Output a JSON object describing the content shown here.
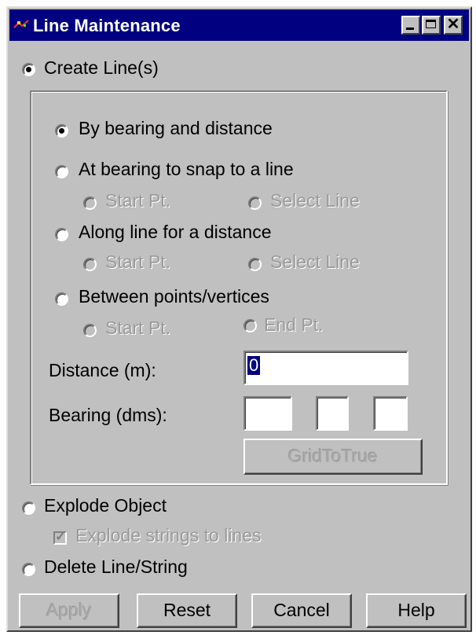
{
  "window": {
    "title": "Line Maintenance"
  },
  "create": {
    "label": "Create Line(s)"
  },
  "options": {
    "by_bearing_distance": "By bearing and distance",
    "snap_to_line": "At bearing to snap to a line",
    "along_line": "Along line for a distance",
    "between_points": "Between points/vertices"
  },
  "sub": {
    "start_pt": "Start Pt.",
    "select_line": "Select Line",
    "end_pt": "End Pt."
  },
  "distance": {
    "label": "Distance (m):",
    "value": "0"
  },
  "bearing": {
    "label": "Bearing (dms):",
    "deg": "",
    "min": "",
    "sec": ""
  },
  "grid_to_true": "GridToTrue",
  "explode": {
    "label": "Explode Object",
    "strings_label": "Explode strings to lines"
  },
  "delete": {
    "label": "Delete Line/String"
  },
  "buttons": {
    "apply": "Apply",
    "reset": "Reset",
    "cancel": "Cancel",
    "help": "Help"
  }
}
